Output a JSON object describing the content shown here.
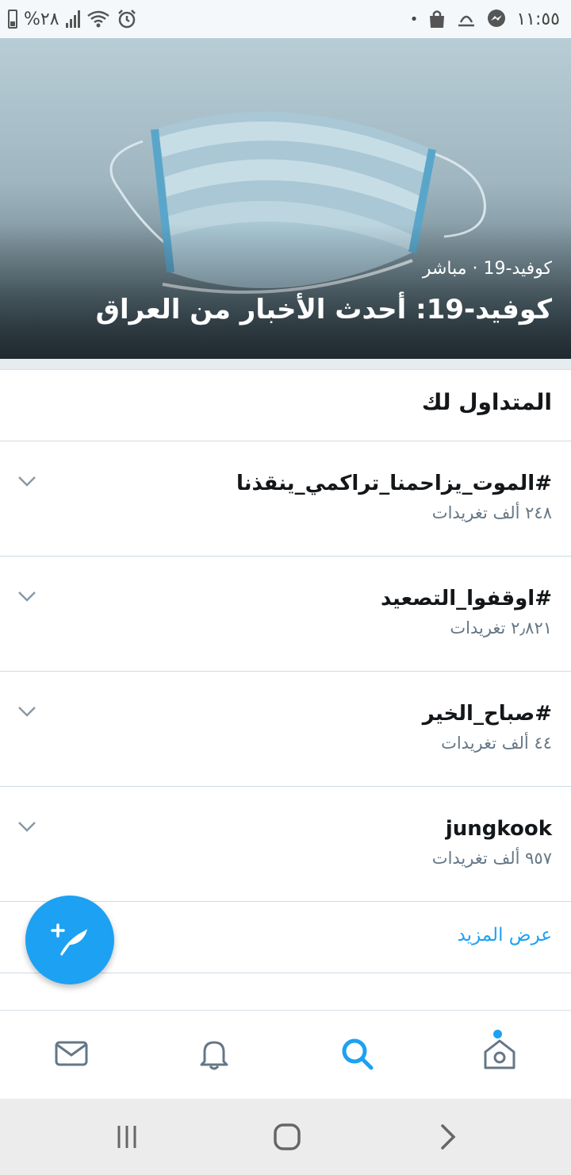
{
  "status_bar": {
    "battery_text": "%٢٨",
    "time": "١١:٥٥",
    "dot": "•"
  },
  "hero": {
    "meta": "كوفيد-19 · مباشر",
    "title": "كوفيد-19: أحدث الأخبار من العراق"
  },
  "trends": {
    "title": "المتداول لك",
    "items": [
      {
        "name": "#الموت_يزاحمنا_تراكمي_ينقذنا",
        "count": "٢٤٨ ألف تغريدات"
      },
      {
        "name": "#اوقفوا_التصعيد",
        "count": "٢٫٨٢١ تغريدات"
      },
      {
        "name": "#صباح_الخير",
        "count": "٤٤ ألف تغريدات"
      },
      {
        "name": "jungkook",
        "count": "٩٥٧ ألف تغريدات"
      }
    ],
    "show_more": "عرض المزيد"
  },
  "colors": {
    "accent": "#1da1f2",
    "icon_gray": "#657786",
    "divider": "#cfdbe0"
  },
  "icons": {
    "fab": "compose-tweet-icon",
    "nav": [
      "messages-icon",
      "notifications-icon",
      "search-icon",
      "home-icon"
    ],
    "system": [
      "recents-icon",
      "home-button-icon",
      "back-icon"
    ]
  }
}
